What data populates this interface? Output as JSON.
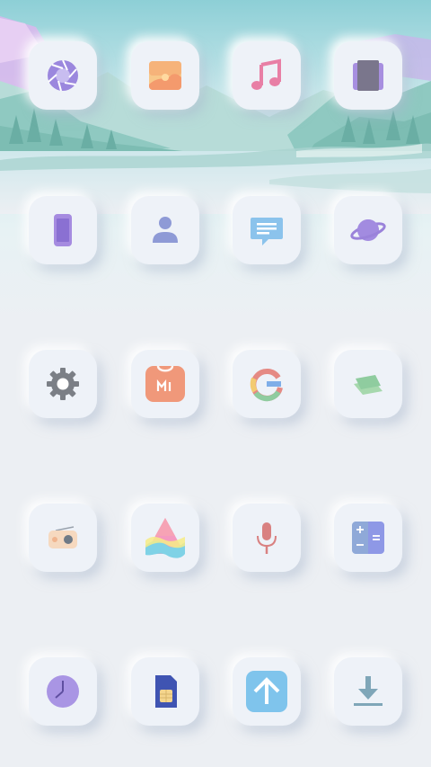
{
  "screen": {
    "wallpaper": "pastel-lake-mountain-landscape",
    "background_color": "#eceff3"
  },
  "home_grid": {
    "rows": [
      [
        {
          "icon": "camera-aperture-icon",
          "color": "#9b87de"
        },
        {
          "icon": "gallery-icon",
          "color": "#f6b37a"
        },
        {
          "icon": "music-icon",
          "color": "#e87fa5"
        },
        {
          "icon": "themes-icon",
          "color": "#7f7a92"
        }
      ],
      [
        {
          "icon": "phone-device-icon",
          "color": "#a58be0"
        },
        {
          "icon": "contacts-icon",
          "color": "#8e9ad6"
        },
        {
          "icon": "messages-icon",
          "color": "#8bc3ec"
        },
        {
          "icon": "browser-planet-icon",
          "color": "#a28be0"
        }
      ],
      [
        {
          "icon": "settings-gear-icon",
          "color": "#7b7f86"
        },
        {
          "icon": "mi-store-icon",
          "color": "#f0987a"
        },
        {
          "icon": "google-icon",
          "color": "#e58a84"
        },
        {
          "icon": "layers-icon",
          "color": "#8fcc9f"
        }
      ],
      [
        {
          "icon": "radio-icon",
          "color": "#f0c9a9"
        },
        {
          "icon": "app-vault-icon",
          "color": "#f49ac0"
        },
        {
          "icon": "recorder-mic-icon",
          "color": "#d98181"
        },
        {
          "icon": "calculator-icon",
          "color": "#8e98e6"
        }
      ],
      [
        {
          "icon": "clock-icon",
          "color": "#a995e4"
        },
        {
          "icon": "sim-toolkit-icon",
          "color": "#3f54b2"
        },
        {
          "icon": "updater-icon",
          "color": "#7fc4ec"
        },
        {
          "icon": "downloads-icon",
          "color": "#7fa6b8"
        }
      ]
    ]
  }
}
